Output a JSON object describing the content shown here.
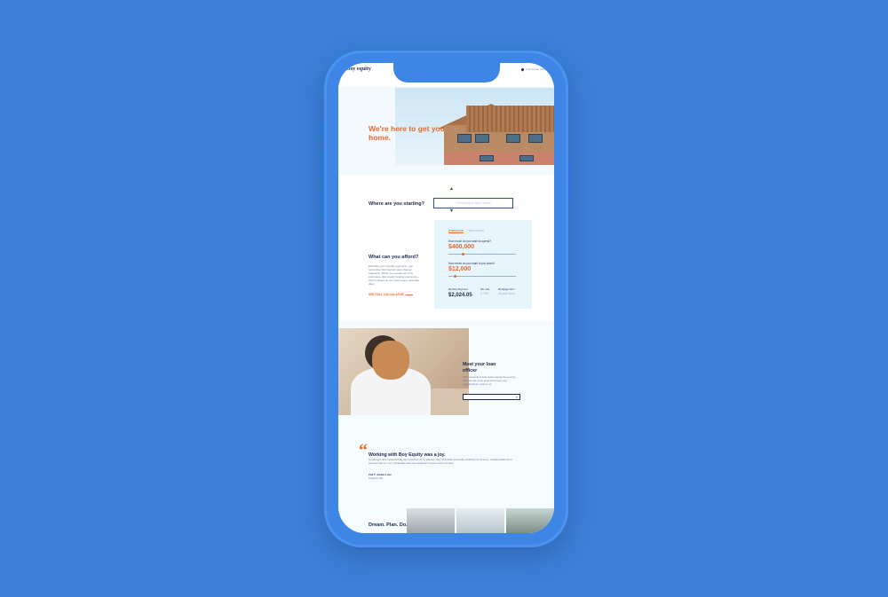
{
  "header": {
    "logo": "boy equity",
    "top_link": "Find a loan officer"
  },
  "hero": {
    "headline": "We're here to get you home."
  },
  "start": {
    "question": "Where are you starting?",
    "input_placeholder": "I'm looking to buy a home"
  },
  "afford": {
    "title": "What can you afford?",
    "description": "Estimate your monthly payments, you remember that interest rates change frequently. While your results are only estimates—like loyalty funding payments—they're based on our most recent, accurate data.",
    "link": "SEE FULL CALCULATOR"
  },
  "calculator": {
    "tab_purchase": "PURCHASE",
    "tab_refinance": "REFINANCE",
    "spend_label": "How much do you want to spend?",
    "spend_value": "$400,000",
    "spend_fraction": 0.2,
    "down_label": "How much do you want to put down?",
    "down_value": "$12,000",
    "down_fraction": 0.08,
    "payment_label": "Monthly Payment",
    "payment_value": "$2,024.05",
    "rate_label": "Intr. rate",
    "rate_value": "4.75%",
    "term_label": "Mortgage Term",
    "term_value": "30 year fixed"
  },
  "loan_officer": {
    "title": "Meet your loan officer",
    "description": "With hundreds of loan teams across the country, chances are pretty good we're near your neighborhood. Look us up."
  },
  "testimonial": {
    "quote_title": "Working with Boy Equity was a joy.",
    "quote_body": "So strength and metaphorically did I conceive of my situation then: that while eventually enabling my recovery, I wanted distinctly to perceive that my own individuality was now assigned to a joint stock company.",
    "author": "Che T. Jordan Luxx",
    "location": "Portland, OR"
  },
  "footer_section": {
    "title": "Dream. Plan. Do."
  },
  "colors": {
    "accent": "#e8692a",
    "navy": "#1b2a4a",
    "background": "#3a7fd9"
  }
}
